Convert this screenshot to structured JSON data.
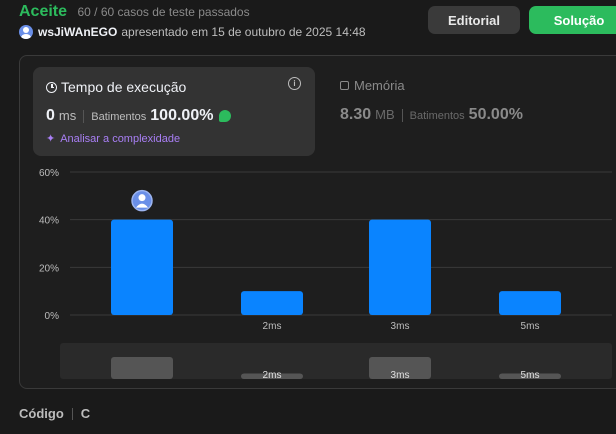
{
  "status": {
    "title": "Aceite",
    "count": "60 / 60 casos de teste passados"
  },
  "submission": {
    "username": "wsJiWAnEGO",
    "text": "apresentado em 15 de outubro de 2025 14:48"
  },
  "buttons": {
    "editorial": "Editorial",
    "solution": "Solução"
  },
  "runtime": {
    "title": "Tempo de execução",
    "value": "0",
    "unit": "ms",
    "beats_label": "Batimentos",
    "beats_value": "100.00%",
    "analyze_label": "Analisar a complexidade"
  },
  "memory": {
    "title": "Memória",
    "value": "8.30",
    "unit": "MB",
    "beats_label": "Batimentos",
    "beats_value": "50.00%"
  },
  "colors": {
    "accent_green": "#2cbb5d",
    "bar_blue": "#0a84ff",
    "purple": "#a97ff5"
  },
  "chart_data": {
    "type": "bar",
    "categories": [
      "",
      "2ms",
      "3ms",
      "5ms"
    ],
    "values": [
      40,
      10,
      40,
      10
    ],
    "y_ticks": [
      "0%",
      "20%",
      "40%",
      "60%"
    ],
    "ylim": [
      0,
      60
    ],
    "grid": true,
    "highlight_index": 0
  },
  "code": {
    "label": "Código",
    "language": "C"
  }
}
